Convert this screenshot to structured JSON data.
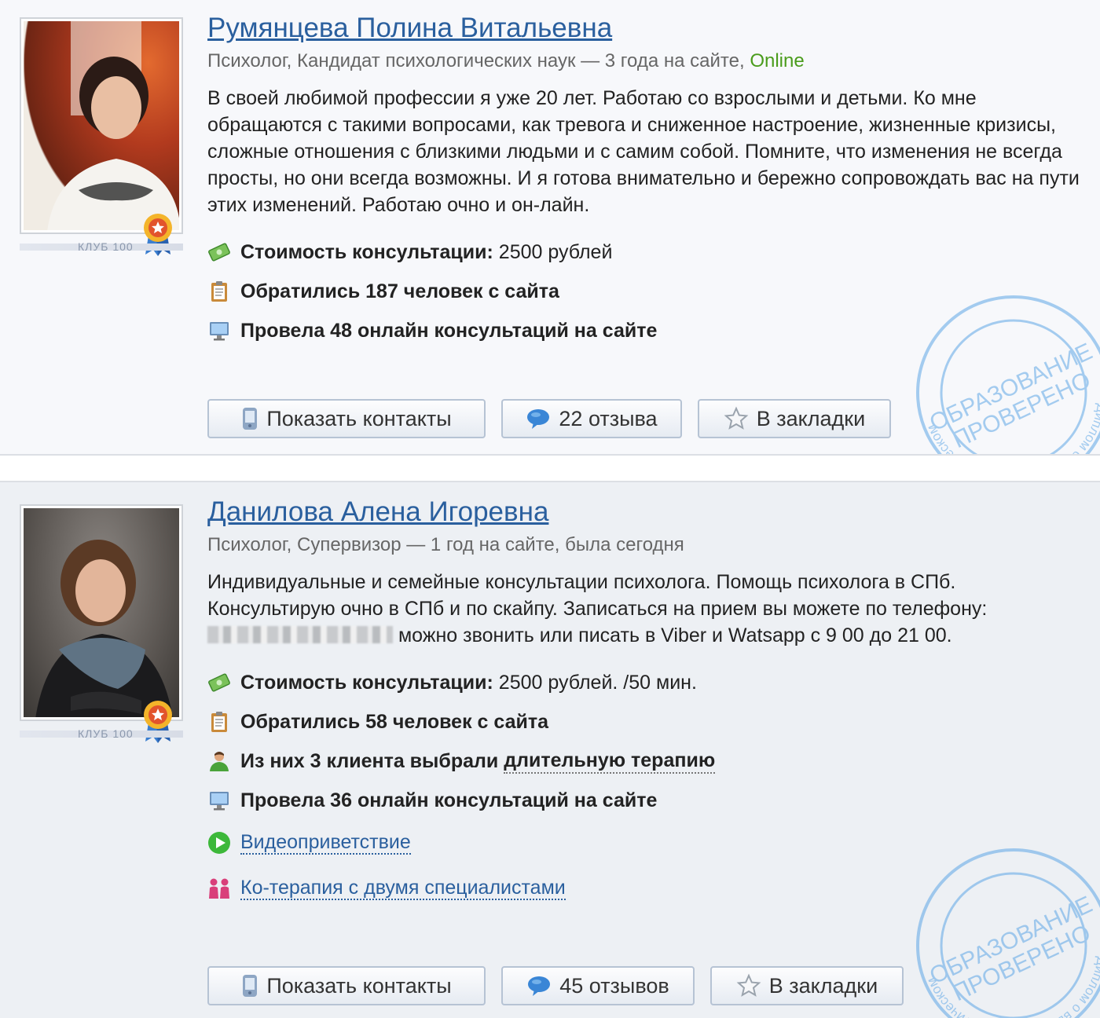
{
  "club_label": "КЛУБ 100",
  "stamp": {
    "ring_text": "Диплом о высшем психологическом",
    "center_line1": "ОБРАЗОВАНИЕ",
    "center_line2": "ПРОВЕРЕНО"
  },
  "cards": [
    {
      "name": "Румянцева Полина Витальевна",
      "subtitle": "Психолог, Кандидат психологических наук — 3 года на сайте,",
      "status": "Online",
      "description": "В своей любимой профессии я уже 20 лет. Работаю со взрослыми и детьми. Ко мне обращаются с такими вопросами, как тревога и сниженное настроение, жизненные кризисы, сложные отношения с близкими людьми и с самим собой. Помните, что изменения не всегда просты, но они всегда возможны. И я готова внимательно и бережно сопровождать вас на пути этих изменений. Работаю очно и он-лайн.",
      "price_label": "Стоимость консультации:",
      "price_value": "2500 рублей",
      "contacted": "Обратились 187 человек с сайта",
      "consultations": "Провела 48 онлайн консультаций на сайте",
      "buttons": {
        "contacts": "Показать контакты",
        "reviews": "22 отзыва",
        "bookmark": "В закладки"
      }
    },
    {
      "name": "Данилова Алена Игоревна",
      "subtitle": "Психолог, Супервизор — 1 год на сайте, была сегодня",
      "description_part1": "Индивидуальные и семейные консультации психолога. Помощь психолога в СПб. Консультирую очно в СПб и по скайпу. Записаться на прием вы можете по телефону:",
      "description_part2": "можно звонить или писать в Viber и Watsapp с 9 00 до 21 00.",
      "price_label": "Стоимость консультации:",
      "price_value": "2500 рублей. /50 мин.",
      "contacted": "Обратились 58 человек с сайта",
      "longterm_prefix": "Из них 3 клиента выбрали",
      "longterm_link": "длительную терапию",
      "consultations": "Провела 36 онлайн консультаций на сайте",
      "video": "Видеоприветствие",
      "cotherapy": "Ко-терапия с двумя специалистами",
      "buttons": {
        "contacts": "Показать контакты",
        "reviews": "45 отзывов",
        "bookmark": "В закладки"
      }
    }
  ]
}
